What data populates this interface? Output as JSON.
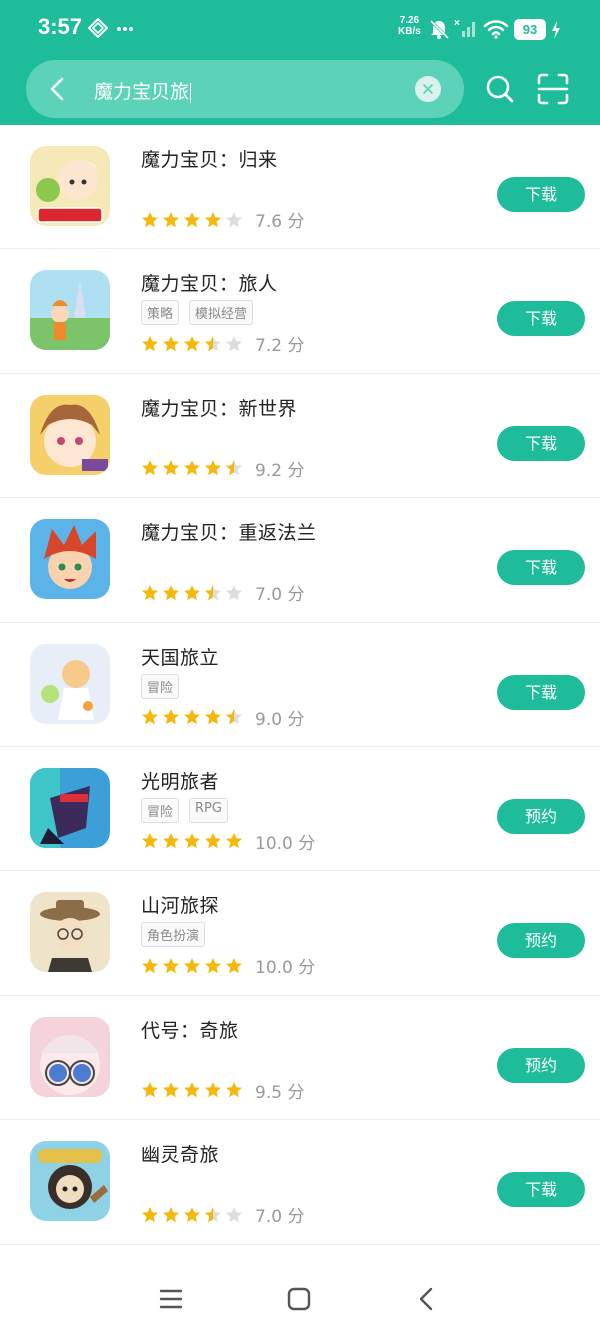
{
  "status_bar": {
    "time": "3:57",
    "net_speed_value": "7.26",
    "net_speed_unit": "KB/s",
    "battery": "93"
  },
  "search": {
    "query": "魔力宝贝旅"
  },
  "colors": {
    "accent": "#1ebc9a",
    "star": "#f5b70a",
    "star_empty": "#dddddd"
  },
  "apps": [
    {
      "name": "魔力宝贝：归来",
      "tags": [],
      "rating": 4,
      "score": "7.6 分",
      "action": "下载",
      "icon": "chibi-hero-icon"
    },
    {
      "name": "魔力宝贝：旅人",
      "tags": [
        "策略",
        "模拟经营"
      ],
      "rating": 3.5,
      "score": "7.2 分",
      "action": "下载",
      "icon": "landscape-traveler-icon"
    },
    {
      "name": "魔力宝贝：新世界",
      "tags": [],
      "rating": 4.5,
      "score": "9.2 分",
      "action": "下载",
      "icon": "anime-girl-icon"
    },
    {
      "name": "魔力宝贝：重返法兰",
      "tags": [],
      "rating": 3.5,
      "score": "7.0 分",
      "action": "下载",
      "icon": "red-hair-boy-icon"
    },
    {
      "name": "天国旅立",
      "tags": [
        "冒险"
      ],
      "rating": 4.5,
      "score": "9.0 分",
      "action": "下载",
      "icon": "pastel-girl-icon"
    },
    {
      "name": "光明旅者",
      "tags": [
        "冒险",
        "RPG"
      ],
      "rating": 5,
      "score": "10.0 分",
      "action": "预约",
      "icon": "pixel-warrior-icon"
    },
    {
      "name": "山河旅探",
      "tags": [
        "角色扮演"
      ],
      "rating": 5,
      "score": "10.0 分",
      "action": "预约",
      "icon": "detective-hat-icon"
    },
    {
      "name": "代号：奇旅",
      "tags": [],
      "rating": 5,
      "score": "9.5 分",
      "action": "预约",
      "icon": "glasses-doll-icon"
    },
    {
      "name": "幽灵奇旅",
      "tags": [],
      "rating": 3.5,
      "score": "7.0 分",
      "action": "下载",
      "icon": "ghost-character-icon"
    }
  ]
}
